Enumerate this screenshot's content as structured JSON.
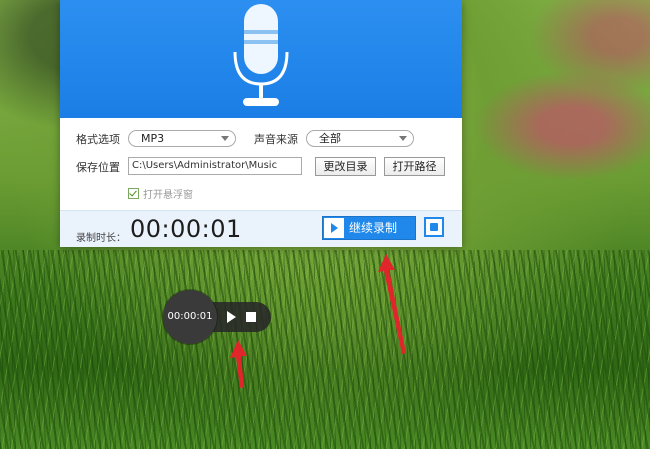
{
  "window": {
    "format_label": "格式选项",
    "format_value": "MP3",
    "source_label": "声音来源",
    "source_value": "全部",
    "save_label": "保存位置",
    "save_path": "C:\\Users\\Administrator\\Music",
    "change_dir_label": "更改目录",
    "open_path_label": "打开路径",
    "floating_window_label": "打开悬浮窗",
    "floating_window_checked": true,
    "duration_label": "录制时长：",
    "duration_value": "00:00:01",
    "continue_label": "继续录制"
  },
  "floating_widget": {
    "time": "00:00:01"
  },
  "icons": {
    "header": "microphone-icon",
    "continue": "play-icon",
    "stop": "stop-icon",
    "float_play": "play-icon",
    "float_stop": "stop-icon"
  },
  "colors": {
    "accent": "#1f88ea",
    "header": "#1a7ee6",
    "annotation_arrow": "#e0262a"
  }
}
